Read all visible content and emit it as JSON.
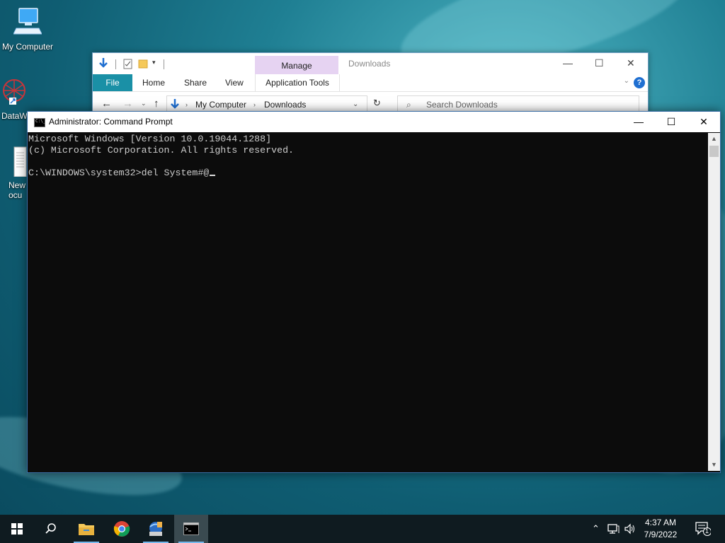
{
  "desktop": {
    "icons": [
      {
        "label": "My Computer",
        "icon": "computer-icon"
      },
      {
        "label": "DataW",
        "icon": "datawrangler-icon"
      },
      {
        "label": "New Docu",
        "icon": "document-icon"
      }
    ]
  },
  "explorer": {
    "title": "Downloads",
    "manage_tab": "Manage",
    "ribbon_tabs": [
      "File",
      "Home",
      "Share",
      "View",
      "Application Tools"
    ],
    "address_path": [
      "My Computer",
      "Downloads"
    ],
    "search_placeholder": "Search Downloads"
  },
  "cmd": {
    "title": "Administrator: Command Prompt",
    "lines": [
      "Microsoft Windows [Version 10.0.19044.1288]",
      "(c) Microsoft Corporation. All rights reserved.",
      "",
      "C:\\WINDOWS\\system32>del System#@"
    ]
  },
  "taskbar": {
    "time": "4:37 AM",
    "date": "7/9/2022",
    "notification_count": "1",
    "apps": [
      "start-icon",
      "search-icon",
      "file-explorer-icon",
      "chrome-icon",
      "app-icon",
      "cmd-icon"
    ]
  },
  "colors": {
    "console_bg": "#0c0c0c",
    "console_text": "#cccccc",
    "taskbar": "#0f1b20",
    "accent": "#1a90a6"
  }
}
